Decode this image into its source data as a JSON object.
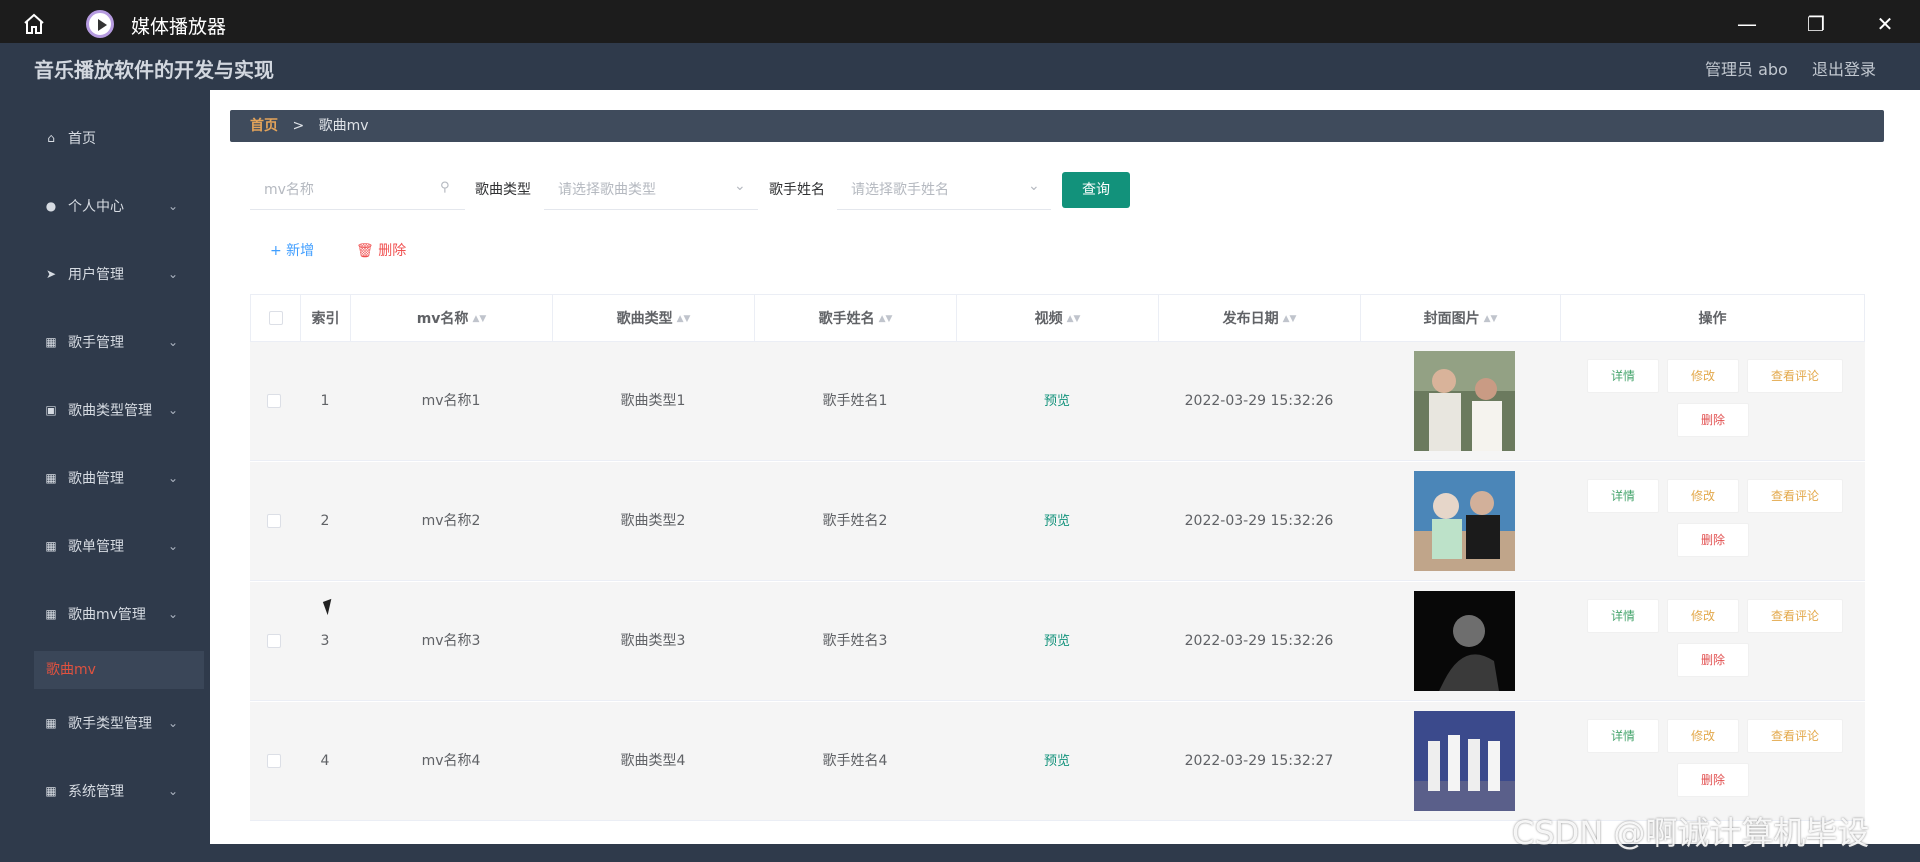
{
  "window": {
    "title": "媒体播放器"
  },
  "header": {
    "app_title": "音乐播放软件的开发与实现",
    "user": "管理员 abo",
    "logout": "退出登录"
  },
  "sidebar": {
    "items": [
      {
        "label": "首页",
        "icon": "home-icon"
      },
      {
        "label": "个人中心",
        "icon": "user-icon"
      },
      {
        "label": "用户管理",
        "icon": "send-icon"
      },
      {
        "label": "歌手管理",
        "icon": "clipboard-icon"
      },
      {
        "label": "歌曲类型管理",
        "icon": "briefcase-icon"
      },
      {
        "label": "歌曲管理",
        "icon": "grid-icon"
      },
      {
        "label": "歌单管理",
        "icon": "clipboard-icon"
      },
      {
        "label": "歌曲mv管理",
        "icon": "grid-icon"
      },
      {
        "label": "歌手类型管理",
        "icon": "grid-icon"
      },
      {
        "label": "系统管理",
        "icon": "grid-icon"
      }
    ],
    "active_sub": "歌曲mv"
  },
  "breadcrumb": {
    "home": "首页",
    "sep": ">",
    "current": "歌曲mv"
  },
  "filter": {
    "mv_name_placeholder": "mv名称",
    "type_label": "歌曲类型",
    "type_placeholder": "请选择歌曲类型",
    "singer_label": "歌手姓名",
    "singer_placeholder": "请选择歌手姓名",
    "query": "查询"
  },
  "toolbar": {
    "add": "+ 新增",
    "delete": "删除"
  },
  "table": {
    "headers": [
      "索引",
      "mv名称",
      "歌曲类型",
      "歌手姓名",
      "视频",
      "发布日期",
      "封面图片",
      "操作"
    ],
    "rows": [
      {
        "index": "1",
        "name": "mv名称1",
        "type": "歌曲类型1",
        "singer": "歌手姓名1",
        "video": "预览",
        "date": "2022-03-29 15:32:26"
      },
      {
        "index": "2",
        "name": "mv名称2",
        "type": "歌曲类型2",
        "singer": "歌手姓名2",
        "video": "预览",
        "date": "2022-03-29 15:32:26"
      },
      {
        "index": "3",
        "name": "mv名称3",
        "type": "歌曲类型3",
        "singer": "歌手姓名3",
        "video": "预览",
        "date": "2022-03-29 15:32:26"
      },
      {
        "index": "4",
        "name": "mv名称4",
        "type": "歌曲类型4",
        "singer": "歌手姓名4",
        "video": "预览",
        "date": "2022-03-29 15:32:27"
      }
    ],
    "ops": {
      "detail": "详情",
      "edit": "修改",
      "comment": "查看评论",
      "delete": "删除"
    }
  },
  "watermark": "CSDN @啊诚计算机毕设"
}
